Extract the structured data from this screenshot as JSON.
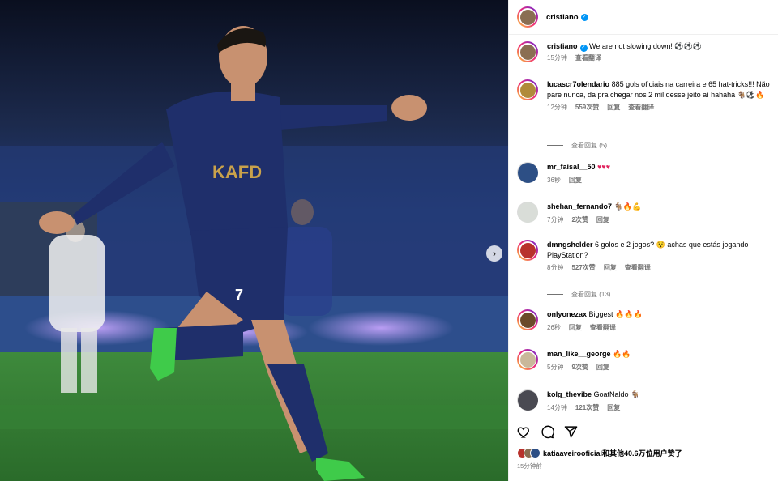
{
  "header": {
    "username": "cristiano"
  },
  "photo": {
    "next_icon": "chevron-right-icon",
    "jersey_sponsor": "KAFD",
    "jersey_number": "7"
  },
  "caption": {
    "username": "cristiano",
    "text": "We are not slowing down! ",
    "emojis": "⚽⚽⚽",
    "time": "15分钟",
    "translate": "查看翻译"
  },
  "comments": [
    {
      "username": "lucascr7olendario",
      "text": "885 gols oficiais na carreira e 65 hat-tricks!!! Não pare nunca, da pra chegar nos 2 mil desse jeito aí hahaha ",
      "emoji": "🐐⚽🔥",
      "time": "12分钟",
      "likes": "559次赞",
      "reply": "回复",
      "translate": "查看翻译",
      "view_replies": "查看回复 (5)"
    },
    {
      "username": "mr_faisal__50",
      "text": "",
      "emoji": "♥♥♥",
      "time": "36秒",
      "reply": "回复"
    },
    {
      "username": "shehan_fernando7",
      "text": "",
      "emoji": "🐐🔥💪",
      "time": "7分钟",
      "likes": "2次赞",
      "reply": "回复"
    },
    {
      "username": "dmngshelder",
      "text": "6 golos e 2 jogos? ",
      "text2": " achas que estás jogando PlayStation?",
      "emoji": "😯",
      "time": "8分钟",
      "likes": "527次赞",
      "reply": "回复",
      "translate": "查看翻译",
      "view_replies": "查看回复 (13)"
    },
    {
      "username": "onlyonezax",
      "text": "Biggest ",
      "emoji": "🔥🔥🔥",
      "time": "26秒",
      "reply": "回复",
      "translate": "查看翻译"
    },
    {
      "username": "man_like__george",
      "text": "",
      "emoji": "🔥🔥",
      "time": "5分钟",
      "likes": "9次赞",
      "reply": "回复"
    },
    {
      "username": "kolg_thevibe",
      "text": "GoatNaldo ",
      "emoji": "🐐",
      "time": "14分钟",
      "likes": "121次赞",
      "reply": "回复"
    }
  ],
  "actions": {
    "like_icon": "heart-icon",
    "comment_icon": "comment-icon",
    "share_icon": "share-icon",
    "liked_by": "katiaaveirooficial",
    "liked_rest": "和其他40.6万位用户赞了",
    "posted": "15分钟前"
  }
}
